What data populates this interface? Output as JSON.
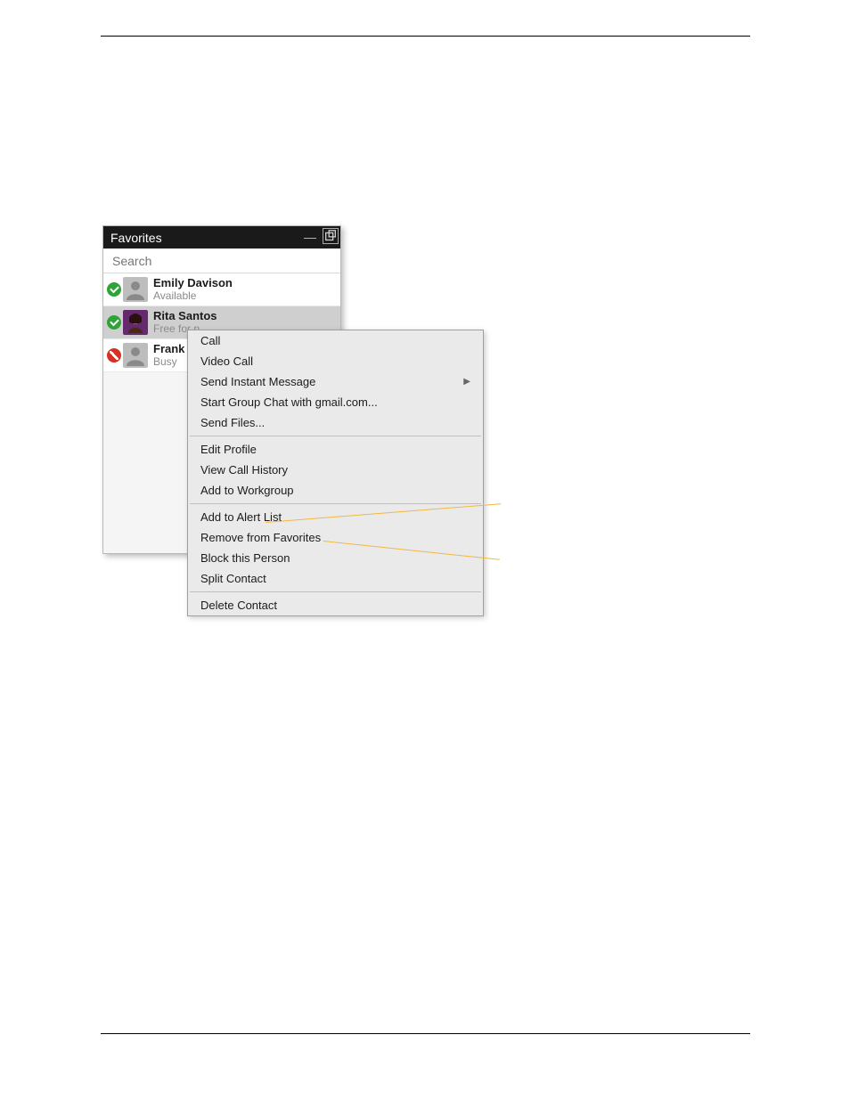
{
  "panel": {
    "title": "Favorites",
    "search_placeholder": "Search"
  },
  "contacts": [
    {
      "name": "Emily Davison",
      "status": "Available",
      "presence": "available",
      "avatar": "silhouette",
      "selected": false
    },
    {
      "name": "Rita Santos",
      "status": "Free for p",
      "presence": "available",
      "avatar": "photo",
      "selected": true
    },
    {
      "name": "Frank Cl",
      "status": "Busy",
      "presence": "busy",
      "avatar": "silhouette",
      "selected": false
    }
  ],
  "context_menu": {
    "groups": [
      [
        "Call",
        "Video Call",
        "Send Instant Message",
        "Start Group Chat with gmail.com...",
        "Send Files..."
      ],
      [
        "Edit Profile",
        "View Call History",
        "Add to Workgroup"
      ],
      [
        "Add to Alert List",
        "Remove from Favorites",
        "Block this Person",
        "Split Contact"
      ],
      [
        "Delete Contact"
      ]
    ],
    "has_submenu": [
      "Send Instant Message"
    ]
  }
}
